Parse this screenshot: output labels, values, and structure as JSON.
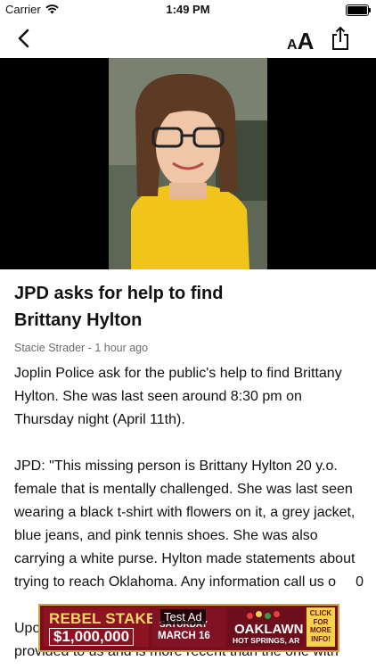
{
  "status_bar": {
    "carrier": "Carrier",
    "time": "1:49 PM"
  },
  "nav": {
    "font_size_label_small": "A",
    "font_size_label_large": "A",
    "icons": [
      "chevron-left-icon",
      "text-size-icon",
      "share-icon"
    ]
  },
  "article": {
    "headline_line1": "JPD asks for help to find",
    "headline_line2": "Brittany Hylton",
    "byline": "Stacie Strader - 1 hour ago",
    "paragraphs": [
      "Joplin Police ask for the public's help to find Brittany Hylton. She was last seen around 8:30 pm on Thursday night (April 11th).",
      "JPD: \"This missing person is Brittany Hylton 20 y.o. female that is mentally challenged. She was last seen wearing a black t-shirt with flowers on it, a grey jacket, blue jeans, and pink tennis shoes. She was also carrying a white purse. Hylton made statements about trying to reach Oklahoma. Any information call us o",
      "Upo",
      "provided to us and is more recent than the one with"
    ],
    "p2_tail": "0"
  },
  "ad": {
    "label": "Test Ad",
    "rebel": "REBEL STAKES",
    "prize": "$1,000,000",
    "saturday": "SATURDAY",
    "date": "MARCH 16",
    "brand": "OAKLAWN",
    "location": "HOT SPRINGS, AR",
    "cta_line1": "CLICK",
    "cta_line2": "FOR",
    "cta_line3": "MORE",
    "cta_line4": "INFO!"
  }
}
